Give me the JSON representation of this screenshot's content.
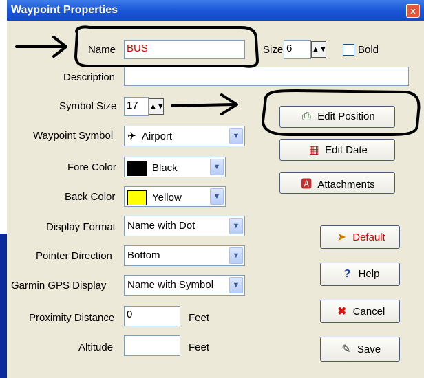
{
  "window": {
    "title": "Waypoint Properties",
    "close_glyph": "x"
  },
  "fields": {
    "name": {
      "label": "Name",
      "value": "BUS"
    },
    "size": {
      "label": "Size",
      "value": "6"
    },
    "bold": {
      "label": "Bold",
      "checked": false
    },
    "description": {
      "label": "Description",
      "value": ""
    },
    "symbol_size": {
      "label": "Symbol Size",
      "value": "17"
    },
    "waypoint_symbol": {
      "label": "Waypoint Symbol",
      "value": "Airport",
      "icon": "airplane-icon"
    },
    "fore_color": {
      "label": "Fore Color",
      "value": "Black",
      "swatch": "#000000"
    },
    "back_color": {
      "label": "Back Color",
      "value": "Yellow",
      "swatch": "#ffff00"
    },
    "display_format": {
      "label": "Display Format",
      "value": "Name with Dot"
    },
    "pointer_direction": {
      "label": "Pointer Direction",
      "value": "Bottom"
    },
    "garmin_display": {
      "label": "Garmin GPS Display",
      "value": "Name with Symbol"
    },
    "proximity": {
      "label": "Proximity Distance",
      "value": "0",
      "unit": "Feet"
    },
    "altitude": {
      "label": "Altitude",
      "value": "",
      "unit": "Feet"
    }
  },
  "buttons": {
    "edit_position": "Edit Position",
    "edit_date": "Edit Date",
    "attachments": "Attachments",
    "default": "Default",
    "help": "Help",
    "cancel": "Cancel",
    "save": "Save"
  },
  "colors": {
    "accent_red": "#d00000",
    "title_blue": "#1a57d8"
  }
}
